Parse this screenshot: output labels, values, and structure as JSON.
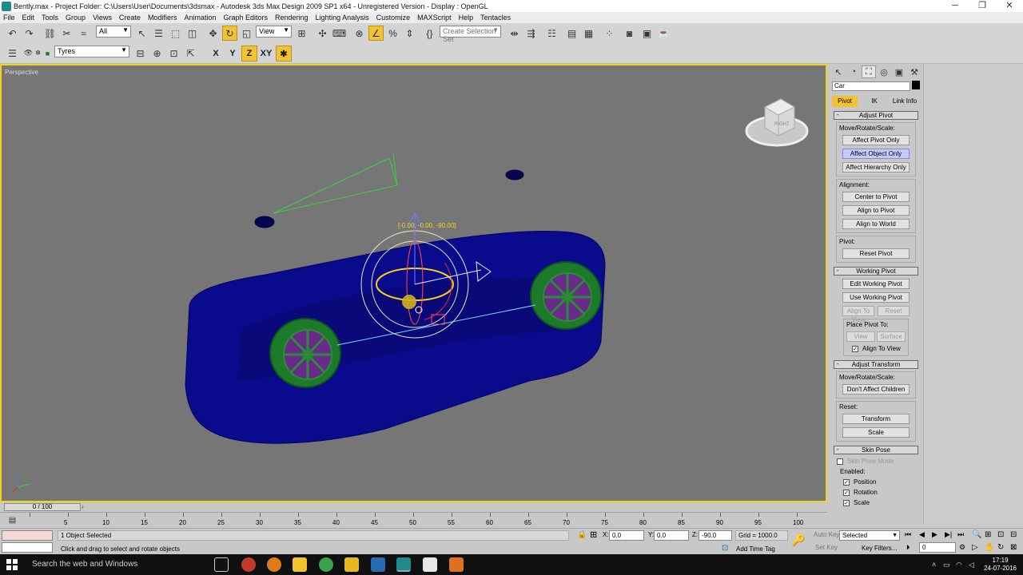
{
  "window": {
    "title": "Bently.max    - Project Folder: C:\\Users\\User\\Documents\\3dsmax    - Autodesk 3ds Max Design 2009 SP1  x64    - Unregistered Version    - Display : OpenGL",
    "minimize": "─",
    "maximize": "❐",
    "close": "✕"
  },
  "menu": [
    "File",
    "Edit",
    "Tools",
    "Group",
    "Views",
    "Create",
    "Modifiers",
    "Animation",
    "Graph Editors",
    "Rendering",
    "Lighting Analysis",
    "Customize",
    "MAXScript",
    "Help",
    "Tentacles"
  ],
  "toolbar": {
    "filter_value": "All",
    "refcoord_value": "View",
    "selection_set_placeholder": "Create Selection Set",
    "layer_value": "Tyres",
    "axis": [
      "X",
      "Y",
      "Z",
      "XY"
    ]
  },
  "viewport": {
    "label": "Perspective",
    "transform_readout": "[-0.00, -0.00, -90.00]",
    "viewcube_label": "RIGHT"
  },
  "command_panel": {
    "object_name": "Car",
    "subtabs": [
      "Pivot",
      "IK",
      "Link Info"
    ],
    "adjust_pivot": {
      "header": "Adjust Pivot",
      "move_label": "Move/Rotate/Scale:",
      "buttons": [
        "Affect Pivot Only",
        "Affect Object Only",
        "Affect Hierarchy Only"
      ],
      "alignment_label": "Alignment:",
      "align_buttons": [
        "Center to Pivot",
        "Align to Pivot",
        "Align to World"
      ],
      "pivot_label": "Pivot:",
      "reset_pivot": "Reset Pivot"
    },
    "working_pivot": {
      "header": "Working Pivot",
      "edit": "Edit Working Pivot",
      "use": "Use Working Pivot",
      "align_to_view": "Align To View",
      "reset": "Reset",
      "place_label": "Place Pivot To:",
      "view": "View",
      "surface": "Surface",
      "align_to_view_chk": "Align To View"
    },
    "adjust_transform": {
      "header": "Adjust Transform",
      "move_label": "Move/Rotate/Scale:",
      "dont_affect": "Don't Affect Children",
      "reset_label": "Reset:",
      "transform": "Transform",
      "scale": "Scale"
    },
    "skin_pose": {
      "header": "Skin Pose",
      "mode": "Skin Pose Mode",
      "enabled_label": "Enabled:",
      "position": "Position",
      "rotation": "Rotation",
      "scale": "Scale"
    }
  },
  "timeline": {
    "slider": "0 / 100",
    "ticks": [
      "0",
      "5",
      "10",
      "15",
      "20",
      "25",
      "30",
      "35",
      "40",
      "45",
      "50",
      "55",
      "60",
      "65",
      "70",
      "75",
      "80",
      "85",
      "90",
      "95",
      "100"
    ]
  },
  "status": {
    "selection": "1 Object Selected",
    "prompt": "Click and drag to select and rotate objects",
    "x_label": "X:",
    "x_value": "0.0",
    "y_label": "Y:",
    "y_value": "0.0",
    "z_label": "Z:",
    "z_value": "-90.0",
    "grid": "Grid = 1000.0",
    "add_time_tag": "Add Time Tag",
    "auto_key": "Auto Key",
    "set_key": "Set Key",
    "key_mode_value": "Selected",
    "key_filters": "Key Filters...",
    "frame_value": "0"
  },
  "taskbar": {
    "search": "Search the web and Windows",
    "time": "17:19",
    "date": "24-07-2016"
  },
  "colors": {
    "car_body": "#0a0a8c",
    "wheel": "#1d7a2a",
    "active_yellow": "#f2c230",
    "viewport_bg": "#767676"
  }
}
